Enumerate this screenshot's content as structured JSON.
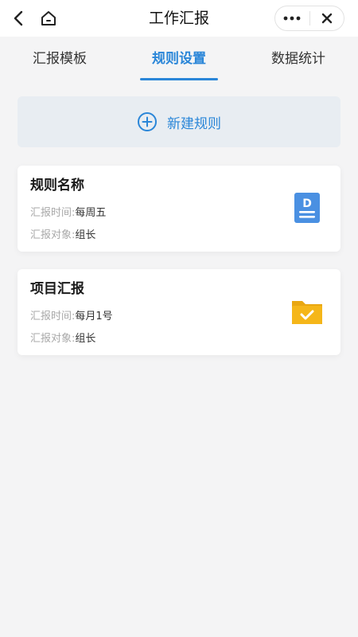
{
  "header": {
    "title": "工作汇报"
  },
  "tabs": [
    {
      "label": "汇报模板",
      "active": false
    },
    {
      "label": "规则设置",
      "active": true
    },
    {
      "label": "数据统计",
      "active": false
    }
  ],
  "new_rule": {
    "label": "新建规则"
  },
  "rules": [
    {
      "name": "规则名称",
      "time_label": "汇报时间:",
      "time_value": "每周五",
      "target_label": "汇报对象:",
      "target_value": "组长",
      "icon": "document-d-icon"
    },
    {
      "name": "项目汇报",
      "time_label": "汇报时间:",
      "time_value": "每月1号",
      "target_label": "汇报对象:",
      "target_value": "组长",
      "icon": "folder-check-icon"
    }
  ],
  "colors": {
    "accent": "#2a86d8",
    "doc_icon": "#4a90e2",
    "folder_icon": "#f5b619",
    "background": "#f4f4f5"
  }
}
